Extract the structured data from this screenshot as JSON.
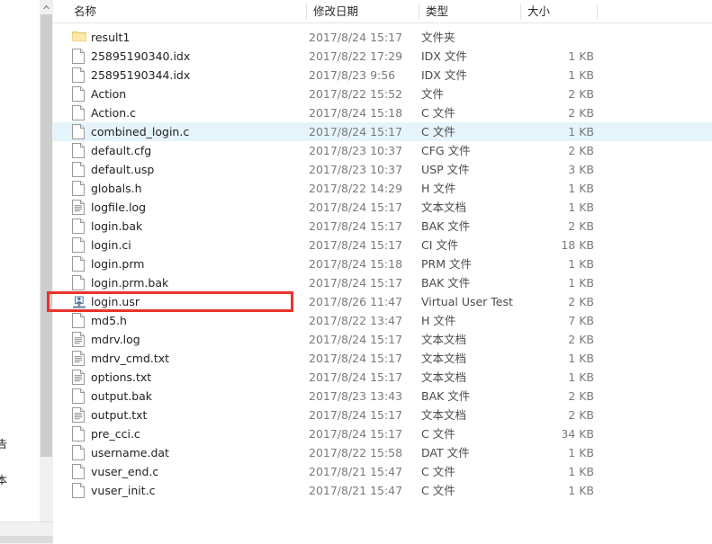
{
  "window": {
    "edge_labels": [
      "告",
      "本"
    ]
  },
  "scrollbar": {
    "up_arrow_icon": "chevron-up-icon"
  },
  "columns": {
    "name": "名称",
    "date_modified": "修改日期",
    "type": "类型",
    "size": "大小"
  },
  "annotation": {
    "target_row_index": 14,
    "color": "#e8332a"
  },
  "selection": {
    "selected_row_index": 5,
    "highlight_color": "#e5f3fb"
  },
  "files": [
    {
      "name": "result1",
      "date": "2017/8/24 15:17",
      "type": "文件夹",
      "size": "",
      "icon": "folder-icon",
      "selected": false
    },
    {
      "name": "25895190340.idx",
      "date": "2017/8/22 17:29",
      "type": "IDX 文件",
      "size": "1 KB",
      "icon": "file-icon",
      "selected": false
    },
    {
      "name": "25895190344.idx",
      "date": "2017/8/23 9:56",
      "type": "IDX 文件",
      "size": "1 KB",
      "icon": "file-icon",
      "selected": false
    },
    {
      "name": "Action",
      "date": "2017/8/22 15:52",
      "type": "文件",
      "size": "2 KB",
      "icon": "file-icon",
      "selected": false
    },
    {
      "name": "Action.c",
      "date": "2017/8/24 15:18",
      "type": "C 文件",
      "size": "2 KB",
      "icon": "file-icon",
      "selected": false
    },
    {
      "name": "combined_login.c",
      "date": "2017/8/24 15:17",
      "type": "C 文件",
      "size": "1 KB",
      "icon": "file-icon",
      "selected": true
    },
    {
      "name": "default.cfg",
      "date": "2017/8/23 10:37",
      "type": "CFG 文件",
      "size": "2 KB",
      "icon": "file-icon",
      "selected": false
    },
    {
      "name": "default.usp",
      "date": "2017/8/23 10:37",
      "type": "USP 文件",
      "size": "3 KB",
      "icon": "file-icon",
      "selected": false
    },
    {
      "name": "globals.h",
      "date": "2017/8/22 14:29",
      "type": "H 文件",
      "size": "1 KB",
      "icon": "file-icon",
      "selected": false
    },
    {
      "name": "logfile.log",
      "date": "2017/8/24 15:17",
      "type": "文本文档",
      "size": "1 KB",
      "icon": "text-file-icon",
      "selected": false
    },
    {
      "name": "login.bak",
      "date": "2017/8/24 15:17",
      "type": "BAK 文件",
      "size": "2 KB",
      "icon": "file-icon",
      "selected": false
    },
    {
      "name": "login.ci",
      "date": "2017/8/24 15:17",
      "type": "CI 文件",
      "size": "18 KB",
      "icon": "file-icon",
      "selected": false
    },
    {
      "name": "login.prm",
      "date": "2017/8/24 15:18",
      "type": "PRM 文件",
      "size": "1 KB",
      "icon": "file-icon",
      "selected": false
    },
    {
      "name": "login.prm.bak",
      "date": "2017/8/24 15:17",
      "type": "BAK 文件",
      "size": "1 KB",
      "icon": "file-icon",
      "selected": false
    },
    {
      "name": "login.usr",
      "date": "2017/8/26 11:47",
      "type": "Virtual User Test",
      "size": "2 KB",
      "icon": "virtual-user-icon",
      "selected": false
    },
    {
      "name": "md5.h",
      "date": "2017/8/22 13:47",
      "type": "H 文件",
      "size": "7 KB",
      "icon": "file-icon",
      "selected": false
    },
    {
      "name": "mdrv.log",
      "date": "2017/8/24 15:17",
      "type": "文本文档",
      "size": "2 KB",
      "icon": "text-file-icon",
      "selected": false
    },
    {
      "name": "mdrv_cmd.txt",
      "date": "2017/8/24 15:17",
      "type": "文本文档",
      "size": "1 KB",
      "icon": "text-file-icon",
      "selected": false
    },
    {
      "name": "options.txt",
      "date": "2017/8/24 15:17",
      "type": "文本文档",
      "size": "1 KB",
      "icon": "text-file-icon",
      "selected": false
    },
    {
      "name": "output.bak",
      "date": "2017/8/23 13:43",
      "type": "BAK 文件",
      "size": "2 KB",
      "icon": "file-icon",
      "selected": false
    },
    {
      "name": "output.txt",
      "date": "2017/8/24 15:17",
      "type": "文本文档",
      "size": "2 KB",
      "icon": "text-file-icon",
      "selected": false
    },
    {
      "name": "pre_cci.c",
      "date": "2017/8/24 15:17",
      "type": "C 文件",
      "size": "34 KB",
      "icon": "file-icon",
      "selected": false
    },
    {
      "name": "username.dat",
      "date": "2017/8/22 15:58",
      "type": "DAT 文件",
      "size": "1 KB",
      "icon": "file-icon",
      "selected": false
    },
    {
      "name": "vuser_end.c",
      "date": "2017/8/21 15:47",
      "type": "C 文件",
      "size": "1 KB",
      "icon": "file-icon",
      "selected": false
    },
    {
      "name": "vuser_init.c",
      "date": "2017/8/21 15:47",
      "type": "C 文件",
      "size": "1 KB",
      "icon": "file-icon",
      "selected": false
    }
  ]
}
